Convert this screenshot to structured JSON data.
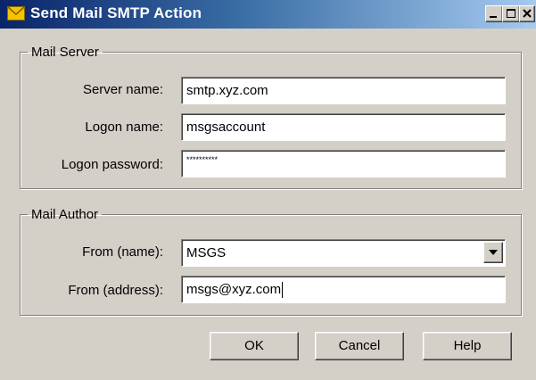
{
  "window": {
    "title": "Send Mail SMTP Action",
    "icon": "envelope-icon",
    "controls": [
      "minimize-icon",
      "maximize-icon",
      "close-icon"
    ]
  },
  "mail_server": {
    "legend": "Mail Server",
    "server_name": {
      "label": "Server name:",
      "value": "smtp.xyz.com"
    },
    "logon_name": {
      "label": "Logon name:",
      "value": "msgsaccount"
    },
    "logon_password": {
      "label": "Logon password:",
      "value": "**********"
    }
  },
  "mail_author": {
    "legend": "Mail Author",
    "from_name": {
      "label": "From (name):",
      "value": "MSGS"
    },
    "from_address": {
      "label": "From (address):",
      "value": "msgs@xyz.com"
    }
  },
  "buttons": {
    "ok": "OK",
    "cancel": "Cancel",
    "help": "Help"
  },
  "colors": {
    "dialog_bg": "#d4d0c8",
    "titlebar_start": "#0a246a",
    "titlebar_end": "#a6caf0",
    "envelope": "#f5c400"
  }
}
